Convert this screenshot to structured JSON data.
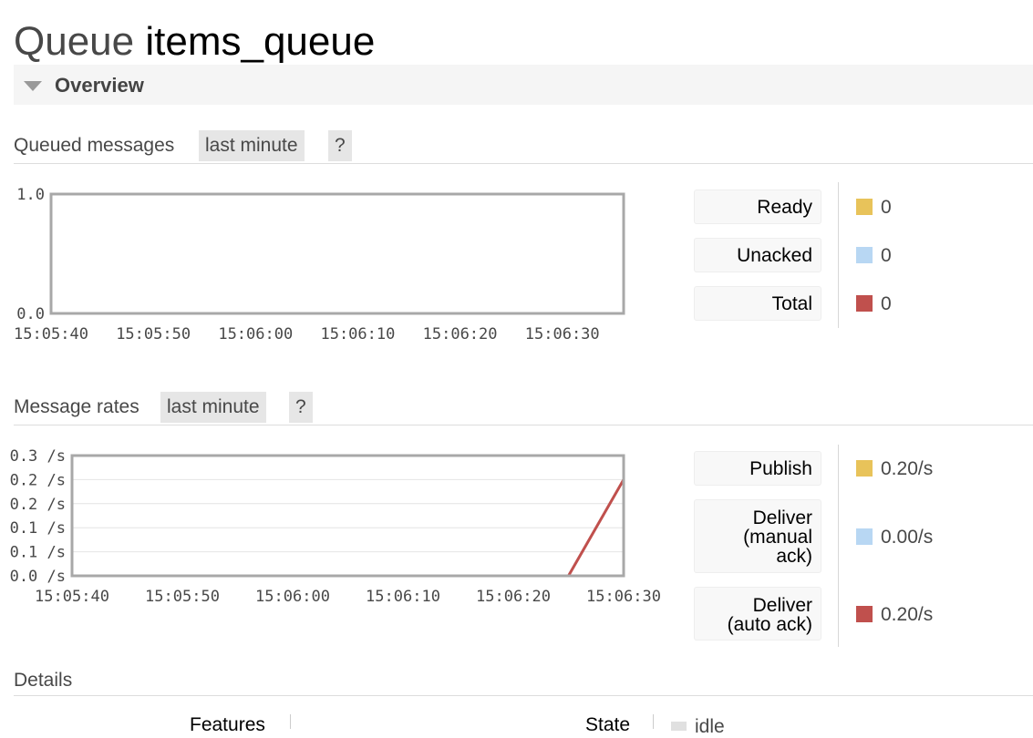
{
  "page": {
    "title_prefix": "Queue",
    "queue_name": "items_queue"
  },
  "overview": {
    "section_label": "Overview"
  },
  "queued_messages": {
    "heading": "Queued messages",
    "range_label": "last minute",
    "help_label": "?",
    "legend": [
      {
        "label": "Ready",
        "value": "0",
        "color": "#e8c35a"
      },
      {
        "label": "Unacked",
        "value": "0",
        "color": "#b8d7f3"
      },
      {
        "label": "Total",
        "value": "0",
        "color": "#c0504d"
      }
    ]
  },
  "message_rates": {
    "heading": "Message rates",
    "range_label": "last minute",
    "help_label": "?",
    "legend": [
      {
        "label_lines": [
          "Publish"
        ],
        "value": "0.20/s",
        "color": "#e8c35a"
      },
      {
        "label_lines": [
          "Deliver",
          "(manual",
          "ack)"
        ],
        "value": "0.00/s",
        "color": "#b8d7f3"
      },
      {
        "label_lines": [
          "Deliver",
          "(auto ack)"
        ],
        "value": "0.20/s",
        "color": "#c0504d"
      }
    ]
  },
  "details": {
    "heading": "Details",
    "features_header": "Features",
    "state_header": "State",
    "state_value": "idle"
  },
  "chart_data": [
    {
      "type": "line",
      "title": "Queued messages",
      "x": [
        "15:05:40",
        "15:05:50",
        "15:06:00",
        "15:06:10",
        "15:06:20",
        "15:06:30"
      ],
      "x_ticks": [
        "15:05:40",
        "15:05:50",
        "15:06:00",
        "15:06:10",
        "15:06:20",
        "15:06:30"
      ],
      "y_ticks": [
        "0.0",
        "1.0"
      ],
      "ylim": [
        0,
        1
      ],
      "series": [
        {
          "name": "Ready",
          "color": "#e8c35a",
          "values": [
            0,
            0,
            0,
            0,
            0,
            0
          ]
        },
        {
          "name": "Unacked",
          "color": "#b8d7f3",
          "values": [
            0,
            0,
            0,
            0,
            0,
            0
          ]
        },
        {
          "name": "Total",
          "color": "#c0504d",
          "values": [
            0,
            0,
            0,
            0,
            0,
            0
          ]
        }
      ]
    },
    {
      "type": "line",
      "title": "Message rates",
      "x": [
        "15:05:40",
        "15:05:50",
        "15:06:00",
        "15:06:10",
        "15:06:20",
        "15:06:25",
        "15:06:30"
      ],
      "x_ticks": [
        "15:05:40",
        "15:05:50",
        "15:06:00",
        "15:06:10",
        "15:06:20",
        "15:06:30"
      ],
      "y_ticks": [
        "0.0 /s",
        "0.1 /s",
        "0.1 /s",
        "0.2 /s",
        "0.2 /s",
        "0.3 /s"
      ],
      "ylim": [
        0,
        0.25
      ],
      "series": [
        {
          "name": "Publish",
          "color": "#e8c35a",
          "values": [
            0,
            0,
            0,
            0,
            0,
            0,
            0
          ]
        },
        {
          "name": "Deliver (manual ack)",
          "color": "#8080c8",
          "values": [
            0,
            0,
            0,
            0,
            0,
            0,
            0
          ]
        },
        {
          "name": "Deliver (auto ack)",
          "color": "#c0504d",
          "values": [
            0,
            0,
            0,
            0,
            0,
            0,
            0.2
          ]
        }
      ]
    }
  ]
}
